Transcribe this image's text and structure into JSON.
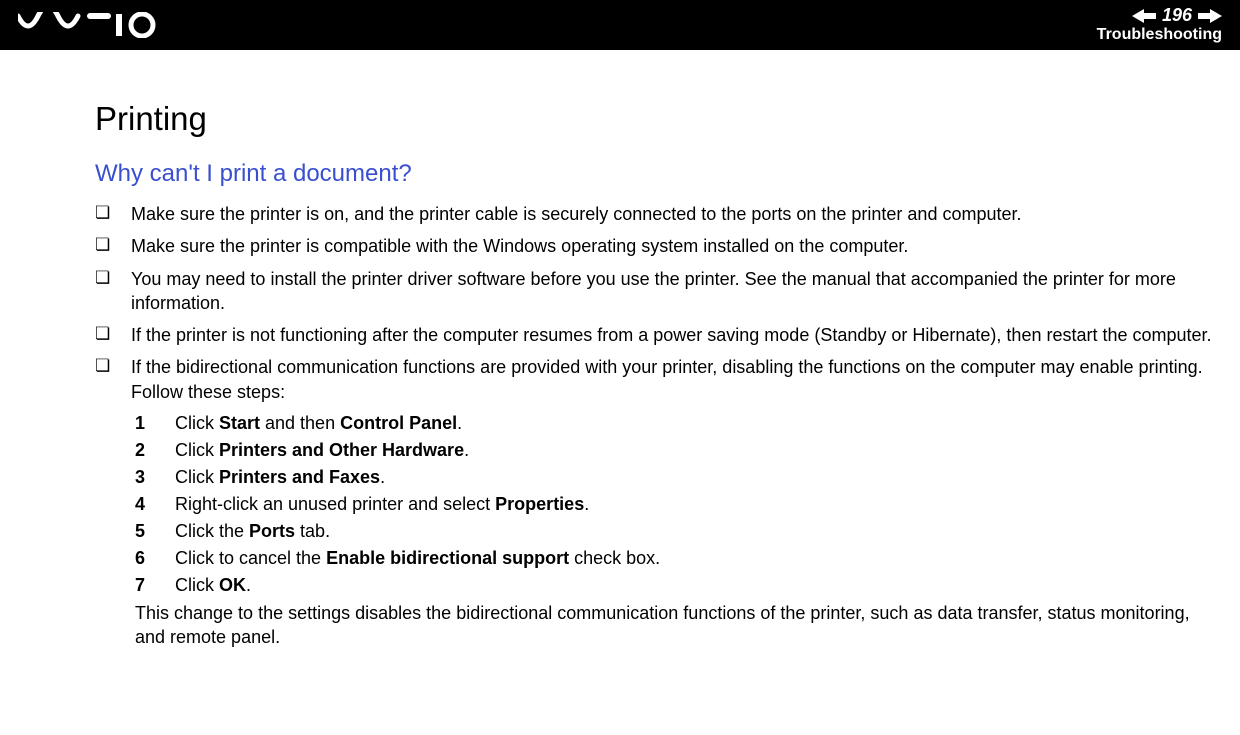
{
  "header": {
    "page_number": "196",
    "section": "Troubleshooting"
  },
  "content": {
    "title": "Printing",
    "question": "Why can't I print a document?",
    "bullets": [
      "Make sure the printer is on, and the printer cable is securely connected to the ports on the printer and computer.",
      "Make sure the printer is compatible with the Windows operating system installed on the computer.",
      "You may need to install the printer driver software before you use the printer. See the manual that accompanied the printer for more information.",
      "If the printer is not functioning after the computer resumes from a power saving mode (Standby or Hibernate), then restart the computer.",
      "If the bidirectional communication functions are provided with your printer, disabling the functions on the computer may enable printing. Follow these steps:"
    ],
    "steps": [
      {
        "pre": "Click ",
        "b1": "Start",
        "mid": " and then ",
        "b2": "Control Panel",
        "post": "."
      },
      {
        "pre": "Click ",
        "b1": "Printers and Other Hardware",
        "mid": "",
        "b2": "",
        "post": "."
      },
      {
        "pre": "Click ",
        "b1": "Printers and Faxes",
        "mid": "",
        "b2": "",
        "post": "."
      },
      {
        "pre": "Right-click an unused printer and select ",
        "b1": "Properties",
        "mid": "",
        "b2": "",
        "post": "."
      },
      {
        "pre": "Click the ",
        "b1": "Ports",
        "mid": "",
        "b2": "",
        "post": " tab."
      },
      {
        "pre": "Click to cancel the ",
        "b1": "Enable bidirectional support",
        "mid": "",
        "b2": "",
        "post": " check box."
      },
      {
        "pre": "Click ",
        "b1": "OK",
        "mid": "",
        "b2": "",
        "post": "."
      }
    ],
    "trail": "This change to the settings disables the bidirectional communication functions of the printer, such as data transfer, status monitoring, and remote panel."
  }
}
